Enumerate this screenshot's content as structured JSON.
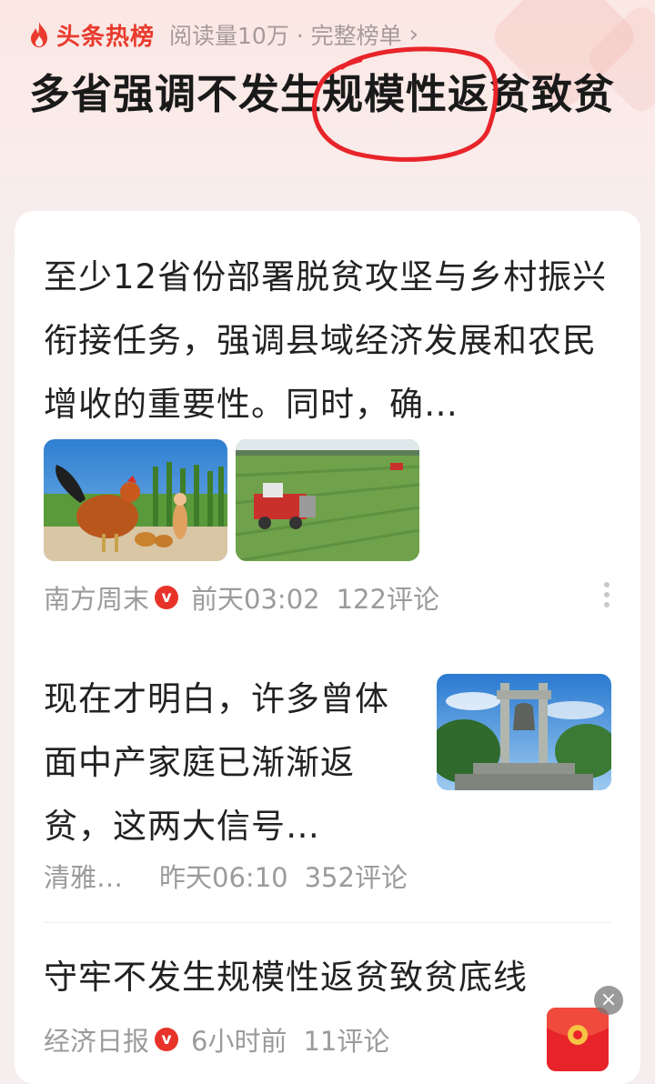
{
  "header": {
    "brand": "头条热榜",
    "stats": "阅读量10万 · 完整榜单",
    "chevron": "›"
  },
  "headline": "多省强调不发生规模性返贫致贫",
  "articles": [
    {
      "title": "至少12省份部署脱贫攻坚与乡村振兴衔接任务，强调县域经济发展和农民增收的重要性。同时，确…",
      "source": "南方周末",
      "verified": "v",
      "time": "前天03:02",
      "comments": "122评论"
    },
    {
      "title": "现在才明白，许多曾体面中产家庭已渐渐返贫，这两大信号…",
      "source": "清雅…",
      "time": "昨天06:10",
      "comments": "352评论"
    },
    {
      "title": "守牢不发生规模性返贫致贫底线",
      "source": "经济日报",
      "verified": "v",
      "time": "6小时前",
      "comments": "11评论"
    }
  ],
  "overlay": {
    "close": "×"
  },
  "colors": {
    "brand_red": "#e83b2d",
    "meta_gray": "#9b9b9b",
    "annotation_red": "#e8242a"
  }
}
